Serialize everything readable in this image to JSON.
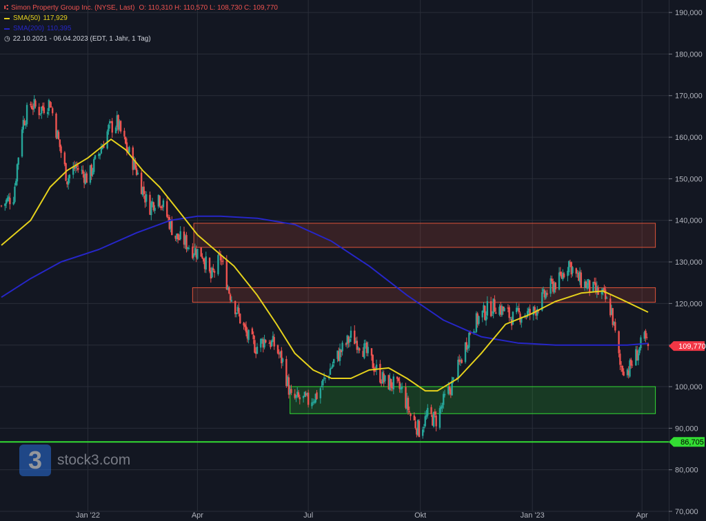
{
  "legend": {
    "main": "Simon Property Group Inc. (NYSE, Last)",
    "ohlc": "O: 110,310  H: 110,570  L: 108,730  C: 109,770",
    "sma50_label": "SMA(50)",
    "sma50_value": "117,929",
    "sma200_label": "SMA(200)",
    "sma200_value": "110,395",
    "range": "22.10.2021 - 06.04.2023  (EDT, 1 Jahr, 1 Tag)"
  },
  "watermark": {
    "logo_char": "3",
    "text": "stock3.com"
  },
  "colors": {
    "background": "#131722",
    "grid": "#2a2e39",
    "up": "#26a69a",
    "down": "#ef5350",
    "sma50": "#e6d21c",
    "sma200": "#2626c8",
    "support_line": "#33dd33",
    "price_label": "#f23645"
  },
  "chart_data": {
    "type": "candlestick",
    "x_range": [
      "2021-10-22",
      "2023-04-06"
    ],
    "ylim": [
      70000,
      193000
    ],
    "y_ticks": [
      "190,000",
      "180,000",
      "170,000",
      "160,000",
      "150,000",
      "140,000",
      "130,000",
      "120,000",
      "110,000",
      "100,000",
      "90,000",
      "80,000",
      "70,000"
    ],
    "x_ticks": [
      "Jan '22",
      "Apr",
      "Jul",
      "Okt",
      "Jan '23",
      "Apr"
    ],
    "last_close": {
      "value": 109770,
      "label": "109,770"
    },
    "support_line": {
      "value": 86705,
      "label": "86,705"
    },
    "zones": [
      {
        "name": "resistance-upper",
        "from_date": "2022-03-29",
        "to_date": "2023-04-12",
        "low": 133500,
        "high": 139300,
        "color": "#e0533a"
      },
      {
        "name": "resistance-lower",
        "from_date": "2022-03-28",
        "to_date": "2023-04-12",
        "low": 120300,
        "high": 123800,
        "color": "#e0533a"
      },
      {
        "name": "support",
        "from_date": "2022-06-16",
        "to_date": "2023-04-12",
        "low": 93500,
        "high": 100000,
        "color": "#33dd33"
      }
    ],
    "series": [
      {
        "name": "Close",
        "points": [
          [
            "2021-10-22",
            143500
          ],
          [
            "2021-11-01",
            146000
          ],
          [
            "2021-11-08",
            163000
          ],
          [
            "2021-11-15",
            168000
          ],
          [
            "2021-11-22",
            166500
          ],
          [
            "2021-12-01",
            168500
          ],
          [
            "2021-12-08",
            159000
          ],
          [
            "2021-12-15",
            150000
          ],
          [
            "2021-12-22",
            153000
          ],
          [
            "2022-01-01",
            150000
          ],
          [
            "2022-01-10",
            156000
          ],
          [
            "2022-01-18",
            162000
          ],
          [
            "2022-01-25",
            163500
          ],
          [
            "2022-02-01",
            158000
          ],
          [
            "2022-02-10",
            152000
          ],
          [
            "2022-02-20",
            143000
          ],
          [
            "2022-02-28",
            146000
          ],
          [
            "2022-03-07",
            141000
          ],
          [
            "2022-03-14",
            136000
          ],
          [
            "2022-03-21",
            135000
          ],
          [
            "2022-03-28",
            133000
          ],
          [
            "2022-04-05",
            132000
          ],
          [
            "2022-04-12",
            126000
          ],
          [
            "2022-04-20",
            131000
          ],
          [
            "2022-04-27",
            123000
          ],
          [
            "2022-05-05",
            117000
          ],
          [
            "2022-05-12",
            112000
          ],
          [
            "2022-05-19",
            109500
          ],
          [
            "2022-05-27",
            111500
          ],
          [
            "2022-06-03",
            110000
          ],
          [
            "2022-06-10",
            106000
          ],
          [
            "2022-06-17",
            97000
          ],
          [
            "2022-06-24",
            97000
          ],
          [
            "2022-07-01",
            96500
          ],
          [
            "2022-07-08",
            98000
          ],
          [
            "2022-07-15",
            102000
          ],
          [
            "2022-07-22",
            106000
          ],
          [
            "2022-07-29",
            109000
          ],
          [
            "2022-08-05",
            112000
          ],
          [
            "2022-08-12",
            110500
          ],
          [
            "2022-08-19",
            107500
          ],
          [
            "2022-08-26",
            104000
          ],
          [
            "2022-09-02",
            101000
          ],
          [
            "2022-09-09",
            100500
          ],
          [
            "2022-09-16",
            99000
          ],
          [
            "2022-09-23",
            93000
          ],
          [
            "2022-09-30",
            89500
          ],
          [
            "2022-10-07",
            93000
          ],
          [
            "2022-10-14",
            92000
          ],
          [
            "2022-10-21",
            97000
          ],
          [
            "2022-10-28",
            101000
          ],
          [
            "2022-11-04",
            107000
          ],
          [
            "2022-11-11",
            113500
          ],
          [
            "2022-11-18",
            116500
          ],
          [
            "2022-11-25",
            118500
          ],
          [
            "2022-12-02",
            119500
          ],
          [
            "2022-12-09",
            118000
          ],
          [
            "2022-12-16",
            116500
          ],
          [
            "2022-12-23",
            117500
          ],
          [
            "2023-01-01",
            117500
          ],
          [
            "2023-01-09",
            121000
          ],
          [
            "2023-01-16",
            124000
          ],
          [
            "2023-01-23",
            125500
          ],
          [
            "2023-01-31",
            130000
          ],
          [
            "2023-02-07",
            126000
          ],
          [
            "2023-02-14",
            124500
          ],
          [
            "2023-02-21",
            123000
          ],
          [
            "2023-02-28",
            122000
          ],
          [
            "2023-03-07",
            118000
          ],
          [
            "2023-03-14",
            105000
          ],
          [
            "2023-03-21",
            104000
          ],
          [
            "2023-03-28",
            108000
          ],
          [
            "2023-04-03",
            111500
          ],
          [
            "2023-04-06",
            109770
          ]
        ]
      },
      {
        "name": "SMA(50)",
        "points": [
          [
            "2021-10-22",
            134000
          ],
          [
            "2021-11-15",
            140000
          ],
          [
            "2021-12-01",
            148000
          ],
          [
            "2021-12-15",
            152000
          ],
          [
            "2022-01-01",
            155000
          ],
          [
            "2022-01-20",
            159500
          ],
          [
            "2022-02-01",
            157000
          ],
          [
            "2022-02-15",
            152000
          ],
          [
            "2022-03-01",
            148000
          ],
          [
            "2022-03-20",
            141000
          ],
          [
            "2022-04-01",
            136500
          ],
          [
            "2022-04-15",
            133000
          ],
          [
            "2022-05-01",
            129000
          ],
          [
            "2022-05-20",
            122000
          ],
          [
            "2022-06-05",
            115000
          ],
          [
            "2022-06-20",
            108000
          ],
          [
            "2022-07-05",
            104000
          ],
          [
            "2022-07-20",
            102000
          ],
          [
            "2022-08-05",
            102000
          ],
          [
            "2022-08-20",
            104000
          ],
          [
            "2022-09-05",
            104500
          ],
          [
            "2022-09-20",
            102000
          ],
          [
            "2022-10-05",
            99000
          ],
          [
            "2022-10-15",
            99000
          ],
          [
            "2022-11-01",
            102000
          ],
          [
            "2022-11-20",
            108000
          ],
          [
            "2022-12-10",
            115000
          ],
          [
            "2022-12-31",
            117500
          ],
          [
            "2023-01-20",
            120500
          ],
          [
            "2023-02-10",
            122500
          ],
          [
            "2023-02-28",
            123000
          ],
          [
            "2023-03-15",
            121000
          ],
          [
            "2023-04-06",
            117900
          ]
        ]
      },
      {
        "name": "SMA(200)",
        "points": [
          [
            "2021-10-22",
            121500
          ],
          [
            "2021-11-15",
            126000
          ],
          [
            "2021-12-10",
            130000
          ],
          [
            "2022-01-10",
            133000
          ],
          [
            "2022-02-10",
            137000
          ],
          [
            "2022-03-10",
            140000
          ],
          [
            "2022-04-01",
            141000
          ],
          [
            "2022-04-20",
            141000
          ],
          [
            "2022-05-20",
            140500
          ],
          [
            "2022-06-20",
            139000
          ],
          [
            "2022-07-20",
            135000
          ],
          [
            "2022-08-20",
            129000
          ],
          [
            "2022-09-20",
            122000
          ],
          [
            "2022-10-20",
            116000
          ],
          [
            "2022-11-20",
            112000
          ],
          [
            "2022-12-20",
            110500
          ],
          [
            "2023-01-20",
            110000
          ],
          [
            "2023-02-20",
            110000
          ],
          [
            "2023-03-20",
            110000
          ],
          [
            "2023-04-06",
            110400
          ]
        ]
      }
    ]
  }
}
